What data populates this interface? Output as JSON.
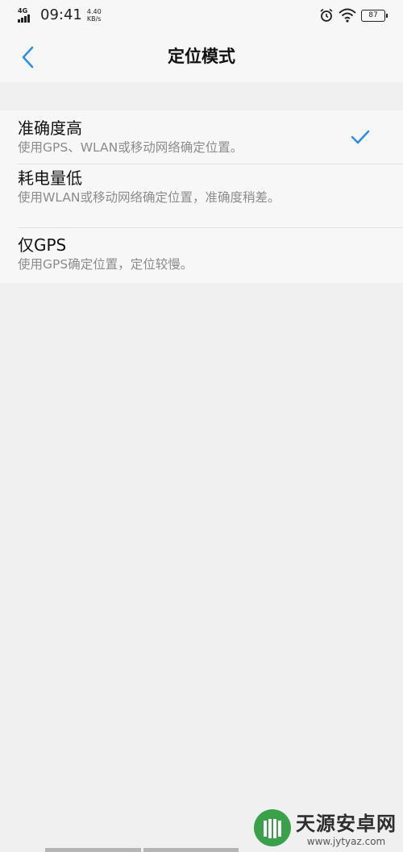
{
  "status_bar": {
    "network": "4G",
    "time": "09:41",
    "speed_value": "4.40",
    "speed_unit": "KB/s",
    "battery": "87"
  },
  "header": {
    "back_icon": "chevron-left-icon",
    "title": "定位模式"
  },
  "options": [
    {
      "title": "准确度高",
      "subtitle": "使用GPS、WLAN或移动网络确定位置。",
      "selected": true
    },
    {
      "title": "耗电量低",
      "subtitle": "使用WLAN或移动网络确定位置，准确度稍差。",
      "selected": false
    },
    {
      "title": "仅GPS",
      "subtitle": "使用GPS确定位置，定位较慢。",
      "selected": false
    }
  ],
  "watermark": {
    "name": "天源安卓网",
    "url": "www.jytyaz.com"
  },
  "colors": {
    "accent": "#2f8fe0",
    "background": "#f0f0f0",
    "surface": "#f7f7f7",
    "subtitle": "#8c8c8c"
  }
}
